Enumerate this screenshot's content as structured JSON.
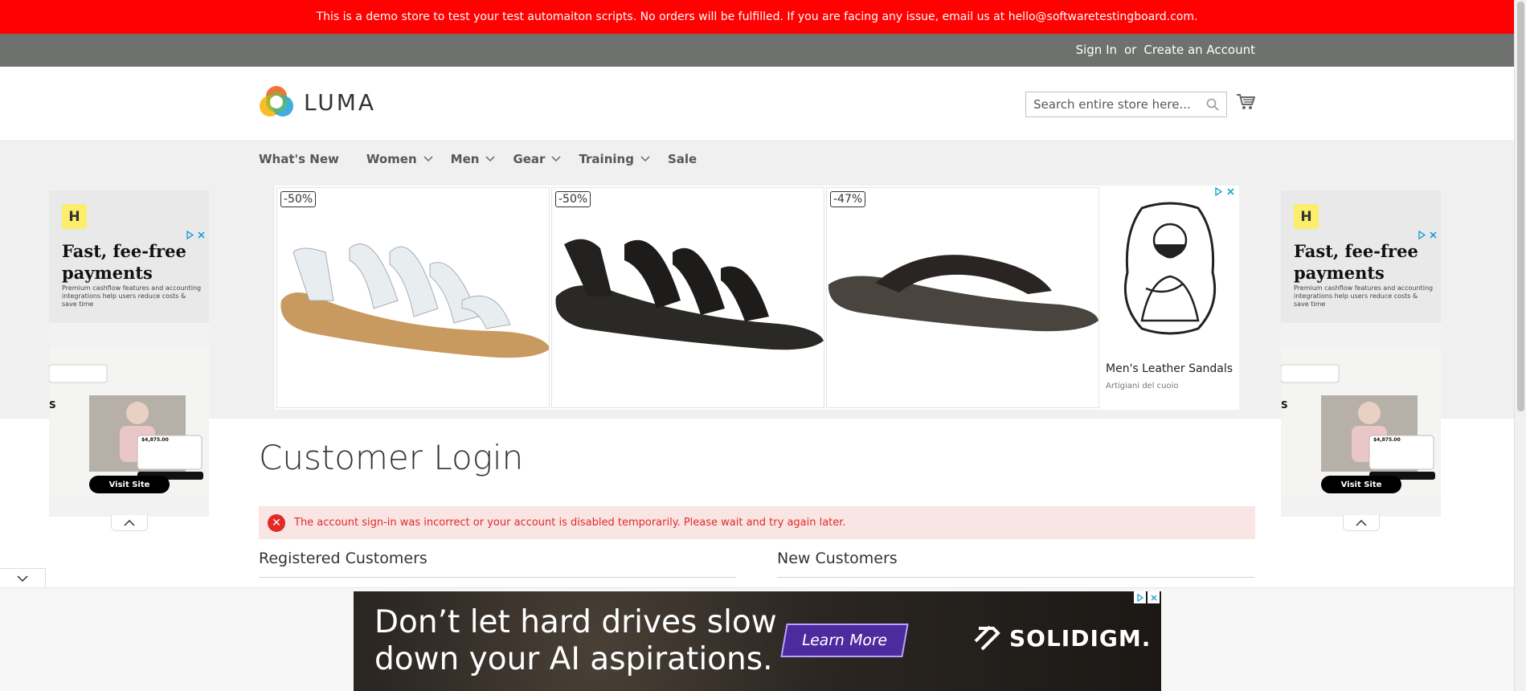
{
  "demo_notice": "This is a demo store to test your test automaiton scripts. No orders will be fulfilled. If you are facing any issue, email us at hello@softwaretestingboard.com.",
  "header": {
    "sign_in": "Sign In",
    "or": "or",
    "create_account": "Create an Account",
    "brand": "LUMA",
    "search_placeholder": "Search entire store here..."
  },
  "nav": {
    "items": [
      {
        "label": "What's New",
        "has_menu": false
      },
      {
        "label": "Women",
        "has_menu": true
      },
      {
        "label": "Men",
        "has_menu": true
      },
      {
        "label": "Gear",
        "has_menu": true
      },
      {
        "label": "Training",
        "has_menu": true
      },
      {
        "label": "Sale",
        "has_menu": false
      }
    ]
  },
  "side_ad": {
    "logo_letter": "H",
    "headline": "Fast, fee-free payments",
    "subtext": "Premium cashflow features and accounting integrations help users reduce costs & save time",
    "amount": "$4,875.00",
    "cta": "Visit Site"
  },
  "center_ad": {
    "products": [
      {
        "discount": "-50%",
        "color": "white"
      },
      {
        "discount": "-50%",
        "color": "black"
      },
      {
        "discount": "-47%",
        "color": "dark-brown"
      }
    ],
    "title": "Men's Leather Sandals",
    "seller": "Artigiani del cuoio"
  },
  "main": {
    "page_title": "Customer Login",
    "error_message": "The account sign-in was incorrect or your account is disabled temporarily. Please wait and try again later.",
    "registered_title": "Registered Customers",
    "new_title": "New Customers"
  },
  "bottom_ad": {
    "headline_line1": "Don’t let hard drives slow",
    "headline_line2": "down your AI aspirations.",
    "cta": "Learn More",
    "brand": "SOLIDIGM."
  },
  "colors": {
    "demo_bar": "#ff0101",
    "header_top": "#6e716e",
    "nav_bg": "#f0f0f0",
    "error_bg": "#fae5e5",
    "error_text": "#e02b27"
  }
}
